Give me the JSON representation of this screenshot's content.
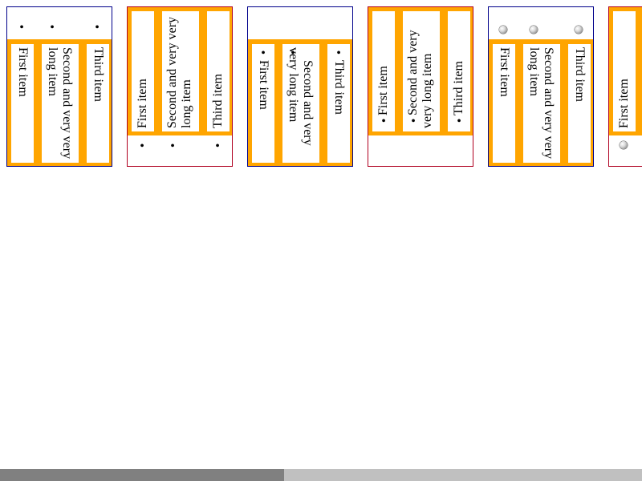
{
  "items": {
    "first": "First item",
    "second": "Second and very very long item",
    "third": "Third item"
  },
  "markers": {
    "bullet": "•"
  },
  "colors": {
    "list_bg": "#ffa500",
    "border_blue": "#00008b",
    "border_red": "#b00020",
    "scroll_track": "#c0c0c0",
    "scroll_thumb": "#808080"
  }
}
